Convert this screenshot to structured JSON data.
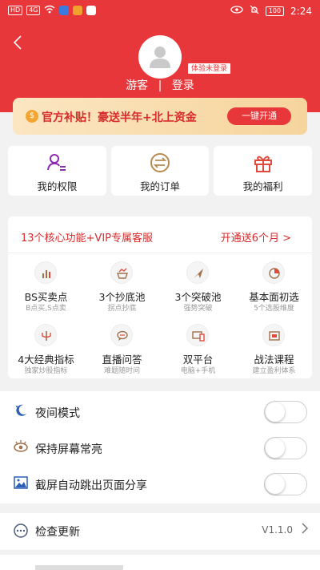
{
  "status_bar": {
    "left_chips": [
      "HD",
      "4G"
    ],
    "time": "2:24",
    "battery": "100"
  },
  "header": {
    "back_icon": "chevron-left-icon",
    "trial_badge": "体验未登录",
    "guest": "游客",
    "separator": "|",
    "login": "登录"
  },
  "promo": {
    "coin": "$",
    "text": "官方补贴！豪送半年+北上资金",
    "button": "一键开通"
  },
  "quick_cards": [
    {
      "label": "我的权限",
      "icon": "user-list-icon"
    },
    {
      "label": "我的订单",
      "icon": "order-exchange-icon"
    },
    {
      "label": "我的福利",
      "icon": "gift-icon"
    }
  ],
  "vip": {
    "title": "13个核心功能+VIP专属客服",
    "link": "开通送6个月 >",
    "items": [
      {
        "name": "BS买卖点",
        "sub": "B点买,S点卖",
        "icon": "signal-bars-icon"
      },
      {
        "name": "3个抄底池",
        "sub": "拐点抄底",
        "icon": "chart-basket-icon"
      },
      {
        "name": "3个突破池",
        "sub": "强势突破",
        "icon": "arrow-up-right-icon"
      },
      {
        "name": "基本面初选",
        "sub": "5个选股维度",
        "icon": "pie-chart-icon"
      },
      {
        "name": "4大经典指标",
        "sub": "独家炒股指标",
        "icon": "trident-icon"
      },
      {
        "name": "直播问答",
        "sub": "难题随时问",
        "icon": "chat-bubble-icon"
      },
      {
        "name": "双平台",
        "sub": "电脑+手机",
        "icon": "devices-icon"
      },
      {
        "name": "战法课程",
        "sub": "建立盈利体系",
        "icon": "video-course-icon"
      }
    ]
  },
  "settings": [
    {
      "label": "夜间模式",
      "icon": "moon-icon",
      "on": false
    },
    {
      "label": "保持屏幕常亮",
      "icon": "eye-icon",
      "on": false
    },
    {
      "label": "截屏自动跳出页面分享",
      "icon": "image-share-icon",
      "on": false
    }
  ],
  "update": {
    "label": "检查更新",
    "version": "V1.1.0",
    "icon": "update-icon"
  },
  "colors": {
    "brand_red": "#e8373a",
    "icon_purple": "#8c2bb0",
    "icon_gold": "#b68a4e",
    "icon_red": "#e04a3c"
  }
}
